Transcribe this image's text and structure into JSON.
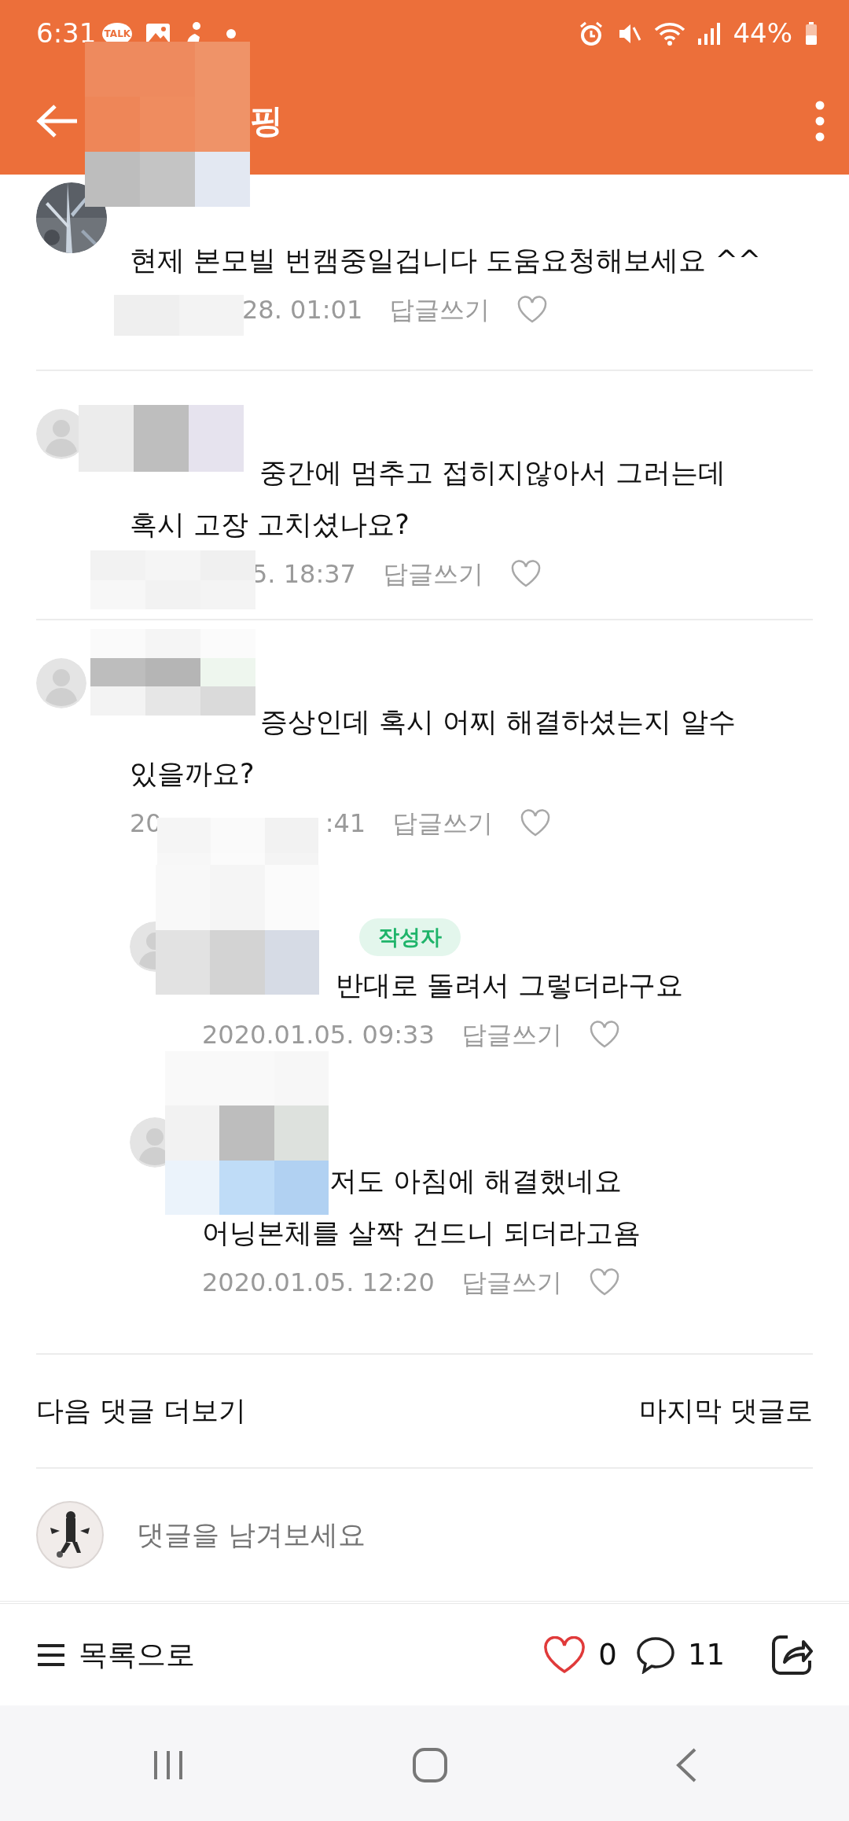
{
  "status_bar": {
    "time": "6:31",
    "talk_badge": "TALK",
    "battery": "44%"
  },
  "app_bar": {
    "title": "핑"
  },
  "comments": [
    {
      "kind": "comment",
      "avatar_photo": true,
      "lines": [
        "현제 본모빌 번캠중일겁니다 도움요청해보세요 ^^"
      ],
      "date": [
        "28. 01:01"
      ],
      "reply_label": "답글쓰기"
    },
    {
      "kind": "comment",
      "avatar_photo": false,
      "lines": [
        "중간에 멈추고 접히지않아서 그러는데",
        "혹시 고장 고치셨나요?"
      ],
      "date": [
        "5. 18:37"
      ],
      "reply_label": "답글쓰기"
    },
    {
      "kind": "comment",
      "avatar_photo": false,
      "lines": [
        "증상인데 혹시 어찌 해결하셨는지 알수",
        "있을까요?"
      ],
      "date": [
        "20",
        ":41"
      ],
      "reply_label": "답글쓰기"
    },
    {
      "kind": "reply",
      "avatar_photo": false,
      "badge": "작성자",
      "lines": [
        "반대로 돌려서 그렇더라구요"
      ],
      "date": [
        "2020.01.05. 09:33"
      ],
      "reply_label": "답글쓰기"
    },
    {
      "kind": "reply",
      "avatar_photo": false,
      "lines": [
        "저도 아침에 해결했네요",
        "어닝본체를 살짝 건드니 되더라고욤"
      ],
      "date": [
        "2020.01.05. 12:20"
      ],
      "reply_label": "답글쓰기"
    }
  ],
  "pager": {
    "next": "다음 댓글 더보기",
    "last": "마지막 댓글로"
  },
  "comment_input": {
    "placeholder": "댓글을 남겨보세요"
  },
  "bottom_bar": {
    "list": "목록으로",
    "likes": "0",
    "comments": "11"
  }
}
